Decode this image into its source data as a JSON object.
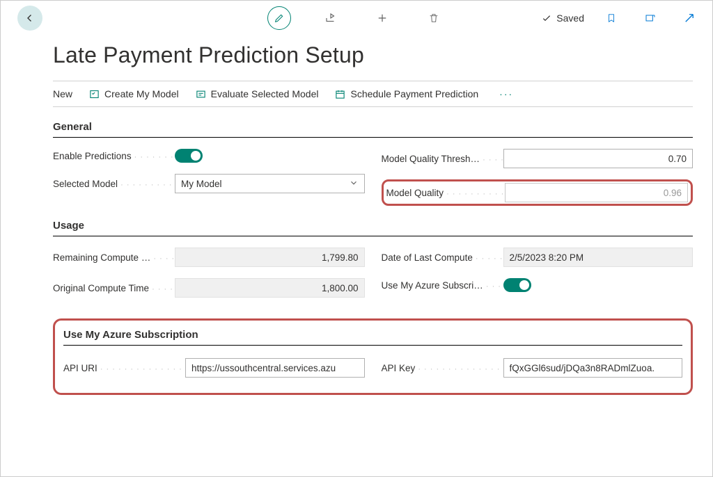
{
  "header": {
    "saved_label": "Saved"
  },
  "page": {
    "title": "Late Payment Prediction Setup"
  },
  "actions": {
    "new": "New",
    "create_model": "Create My Model",
    "evaluate": "Evaluate Selected Model",
    "schedule": "Schedule Payment Prediction"
  },
  "general": {
    "title": "General",
    "enable_predictions_label": "Enable Predictions",
    "selected_model_label": "Selected Model",
    "selected_model_value": "My Model",
    "model_quality_threshold_label": "Model Quality Thresh…",
    "model_quality_threshold_value": "0.70",
    "model_quality_label": "Model Quality",
    "model_quality_value": "0.96"
  },
  "usage": {
    "title": "Usage",
    "remaining_compute_label": "Remaining Compute …",
    "remaining_compute_value": "1,799.80",
    "original_compute_label": "Original Compute Time",
    "original_compute_value": "1,800.00",
    "date_last_compute_label": "Date of Last Compute",
    "date_last_compute_value": "2/5/2023 8:20 PM",
    "use_azure_sub_label": "Use My Azure Subscri…"
  },
  "azure": {
    "title": "Use My Azure Subscription",
    "api_uri_label": "API URI",
    "api_uri_value": "https://ussouthcentral.services.azu",
    "api_key_label": "API Key",
    "api_key_value": "fQxGGl6sud/jDQa3n8RADmlZuoa."
  }
}
